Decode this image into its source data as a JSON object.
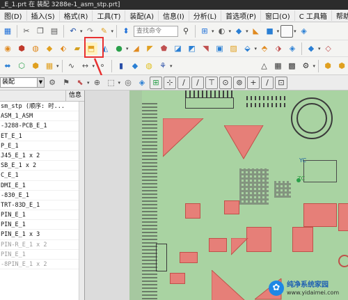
{
  "window": {
    "title": "_E_1.prt 在 装配 3288e-1_asm_stp.prt]"
  },
  "menu": [
    "图(D)",
    "插入(S)",
    "格式(R)",
    "工具(T)",
    "装配(A)",
    "信息(I)",
    "分析(L)",
    "首选项(P)",
    "窗口(O)",
    "C 工具箱",
    "帮助(H)"
  ],
  "toolbar": {
    "command_search_placeholder": "查找命令"
  },
  "assembly_bar": {
    "selected_filter": "装配"
  },
  "navigator": {
    "header_info": "信息",
    "rows": [
      "sm_stp (顺序: 时...",
      "ASM_1_ASM",
      "-3288-PCB_E_1",
      "ET_E_1",
      "P_E_1",
      "J45_E_1 x 2",
      "SB_E_1 x 2",
      "C_E_1",
      "DMI_E_1",
      "-830_E_1",
      "TRT-83D_E_1",
      "PIN_E_1",
      "PIN_E_1",
      "PIN_E_1 x 3",
      "PIN-R_E_1 x 2",
      "PIN_E_1",
      "-8PIN_E_1 x 2"
    ],
    "dim_from_index": 14
  },
  "viewport": {
    "axis_label_yc": "YC",
    "axis_label_zc": "ZC"
  },
  "watermark": {
    "text": "纯净系统家园",
    "url": "www.yidaimei.com"
  },
  "colors": {
    "pcb": "#a9d3a2",
    "pad": "#e67f78",
    "highlight": "#e83030"
  }
}
